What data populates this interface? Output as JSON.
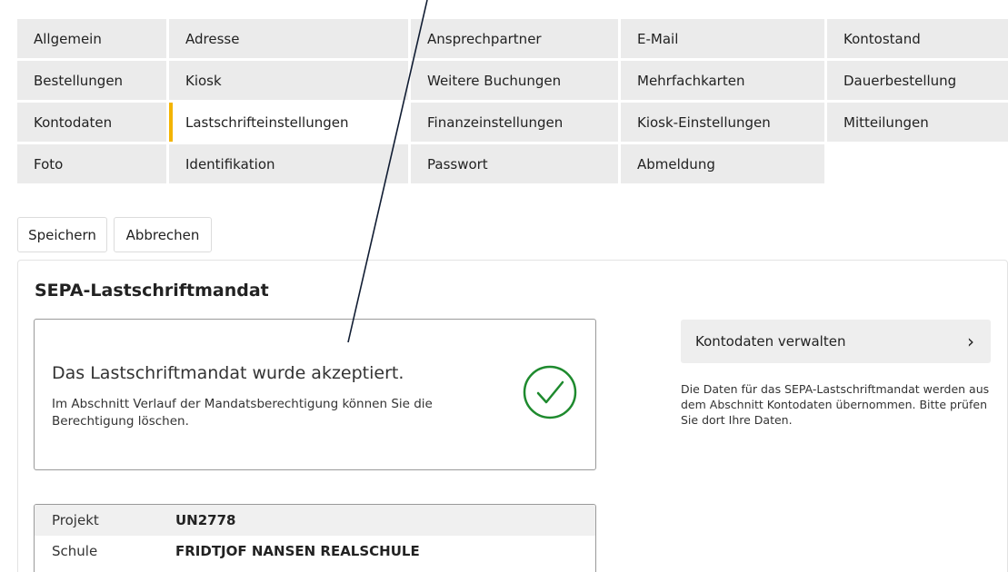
{
  "tabs": [
    {
      "label": "Allgemein",
      "active": false
    },
    {
      "label": "Adresse",
      "active": false
    },
    {
      "label": "Ansprechpartner",
      "active": false
    },
    {
      "label": "E-Mail",
      "active": false
    },
    {
      "label": "Kontostand",
      "active": false
    },
    {
      "label": "Bestellungen",
      "active": false
    },
    {
      "label": "Kiosk",
      "active": false
    },
    {
      "label": "Weitere Buchungen",
      "active": false
    },
    {
      "label": "Mehrfachkarten",
      "active": false
    },
    {
      "label": "Dauerbestellung",
      "active": false
    },
    {
      "label": "Kontodaten",
      "active": false
    },
    {
      "label": "Lastschrifteinstellungen",
      "active": true
    },
    {
      "label": "Finanzeinstellungen",
      "active": false
    },
    {
      "label": "Kiosk-Einstellungen",
      "active": false
    },
    {
      "label": "Mitteilungen",
      "active": false
    },
    {
      "label": "Foto",
      "active": false
    },
    {
      "label": "Identifikation",
      "active": false
    },
    {
      "label": "Passwort",
      "active": false
    },
    {
      "label": "Abmeldung",
      "active": false
    }
  ],
  "toolbar": {
    "save_label": "Speichern",
    "cancel_label": "Abbrechen"
  },
  "section": {
    "title": "SEPA-Lastschriftmandat",
    "status_title": "Das Lastschriftmandat wurde akzeptiert.",
    "status_desc": "Im Abschnitt Verlauf der Mandatsberechtigung können Sie die Berechtigung löschen.",
    "status_icon": "check-circle-icon",
    "status_color": "#1e8a2e"
  },
  "info": {
    "rows": [
      {
        "label": "Projekt",
        "value": "UN2778"
      },
      {
        "label": "Schule",
        "value": "FRIDTJOF NANSEN REALSCHULE"
      }
    ]
  },
  "sidepanel": {
    "manage_label": "Kontodaten verwalten",
    "manage_chevron": "›",
    "note": "Die Daten für das SEPA-Lastschriftmandat werden aus dem Abschnitt Kontodaten übernommen. Bitte prüfen Sie dort Ihre Daten."
  },
  "colors": {
    "active_tab_accent": "#f3b400",
    "tab_bg": "#ebebeb"
  }
}
